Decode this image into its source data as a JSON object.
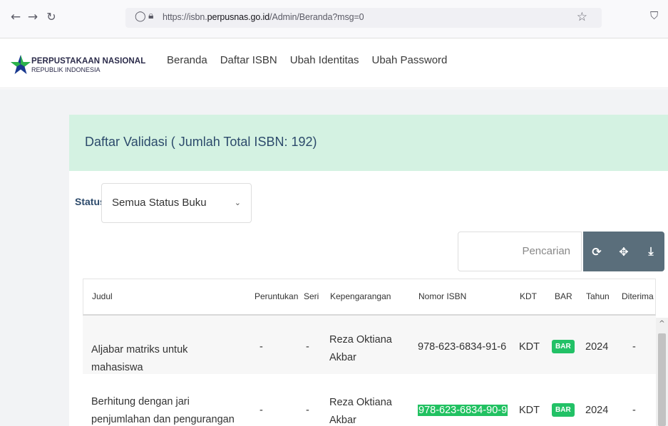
{
  "browser": {
    "back_icon": "arrow-left-icon",
    "forward_icon": "arrow-right-icon",
    "reload_icon": "reload-icon",
    "url_prefix": "https://isbn.",
    "url_domain": "perpusnas.go.id",
    "url_path": "/Admin/Beranda?msg=0",
    "bookmark_icon": "star-icon",
    "pocket_icon": "pocket-icon"
  },
  "site": {
    "logo_title": "PERPUSTAKAAN NASIONAL",
    "logo_subtitle": "REPUBLIK INDONESIA",
    "menu": [
      "Beranda",
      "Daftar ISBN",
      "Ubah Identitas",
      "Ubah Password"
    ]
  },
  "panel": {
    "title": "Daftar Validasi ( Jumlah Total ISBN: 192)",
    "status_label": "Status",
    "status_value": "Semua Status Buku",
    "search_placeholder": "Pencarian",
    "toolbar_icons": [
      "refresh-icon",
      "move-icon",
      "download-icon"
    ]
  },
  "table": {
    "columns": [
      "Judul",
      "Peruntukan",
      "Seri",
      "Kepengarangan",
      "Nomor ISBN",
      "KDT",
      "BAR",
      "Tahun",
      "Diterima"
    ],
    "rows": [
      {
        "judul": "Aljabar matriks untuk mahasiswa",
        "peruntukan": "-",
        "seri": "-",
        "kepengarangan": "Reza Oktiana Akbar",
        "isbn": "978-623-6834-91-6",
        "kdt": "KDT",
        "bar": "BAR",
        "tahun": "2024",
        "diterima": "-"
      },
      {
        "judul": "Berhitung dengan jari penjumlahan dan pengurangan",
        "peruntukan": "-",
        "seri": "-",
        "kepengarangan": "Reza Oktiana Akbar",
        "isbn": "978-623-6834-90-9",
        "kdt": "KDT",
        "bar": "BAR",
        "tahun": "2024",
        "diterima": "-"
      }
    ]
  },
  "colors": {
    "header_bg": "#d4f2e2",
    "title_color": "#2c4a6b",
    "badge_green": "#22c166",
    "toolbar_bg": "#5a6e7b"
  }
}
